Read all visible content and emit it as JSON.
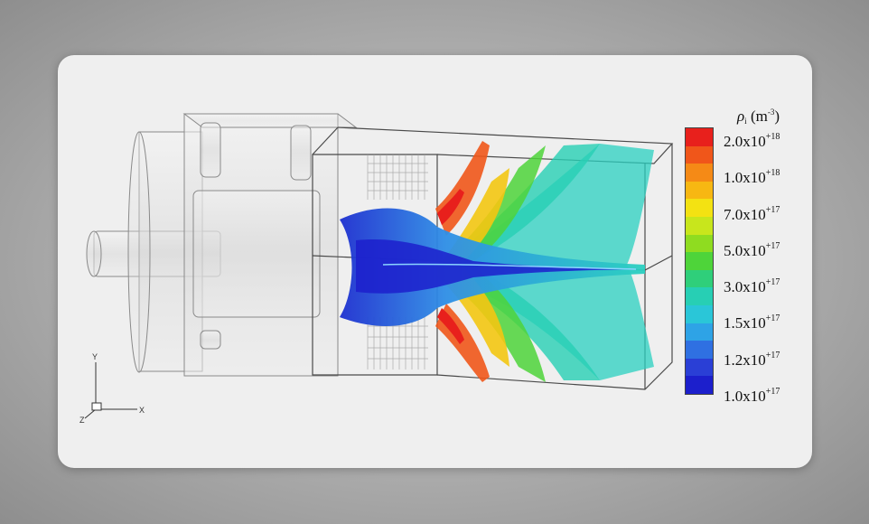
{
  "legend": {
    "title_symbol": "ρ",
    "title_subscript": "i",
    "title_unit": "(m",
    "title_unit_exp": "-3",
    "title_unit_close": ")",
    "ticks": [
      {
        "mantissa": "2.0x10",
        "exp": "+18"
      },
      {
        "mantissa": "1.0x10",
        "exp": "+18"
      },
      {
        "mantissa": "7.0x10",
        "exp": "+17"
      },
      {
        "mantissa": "5.0x10",
        "exp": "+17"
      },
      {
        "mantissa": "3.0x10",
        "exp": "+17"
      },
      {
        "mantissa": "1.5x10",
        "exp": "+17"
      },
      {
        "mantissa": "1.2x10",
        "exp": "+17"
      },
      {
        "mantissa": "1.0x10",
        "exp": "+17"
      }
    ],
    "colors": [
      "#e8201c",
      "#f0561a",
      "#f58a16",
      "#f7b712",
      "#f3e212",
      "#c8e61c",
      "#8fdc20",
      "#4ed43a",
      "#2fcf7a",
      "#27cfb4",
      "#2ac6d8",
      "#2ea3e6",
      "#2f70e2",
      "#2a3fd6",
      "#1c1fcc"
    ]
  },
  "axes": {
    "x": "X",
    "y": "Y",
    "z": "Z"
  }
}
